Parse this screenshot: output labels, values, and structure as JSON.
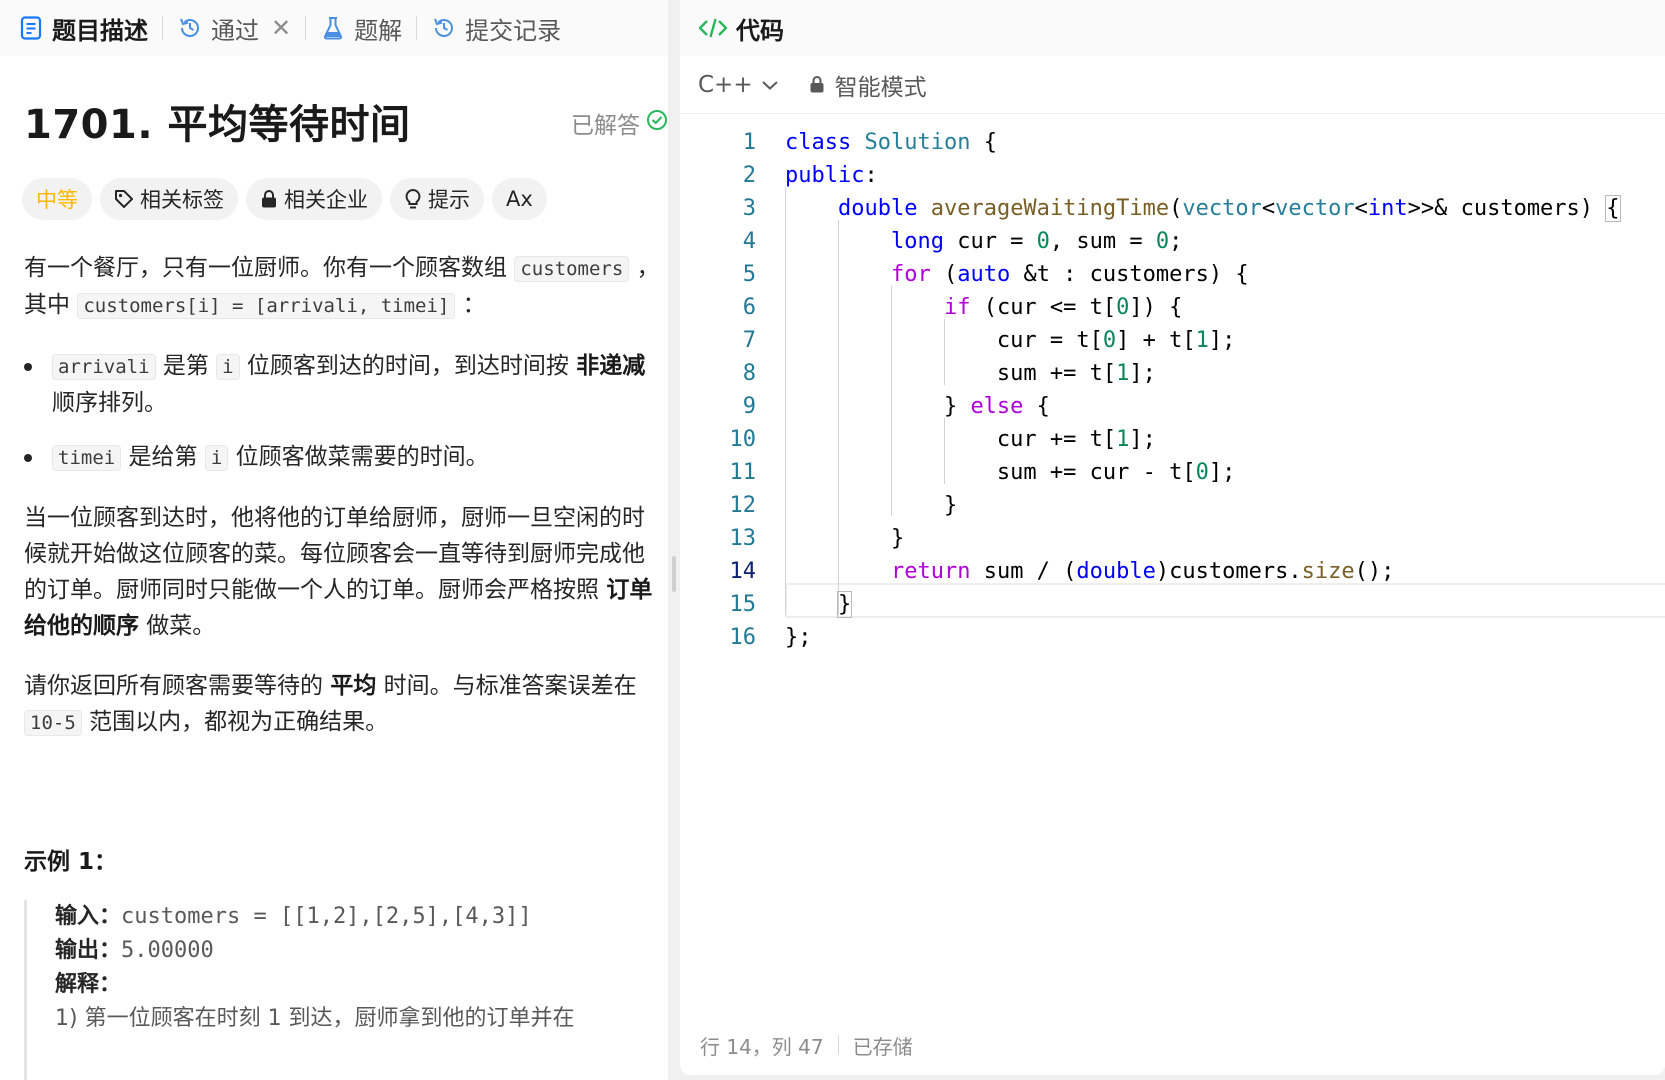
{
  "tabs": [
    {
      "label": "题目描述",
      "icon": "document-icon",
      "active": true
    },
    {
      "label": "通过",
      "icon": "history-icon",
      "closable": true
    },
    {
      "label": "题解",
      "icon": "flask-icon"
    },
    {
      "label": "提交记录",
      "icon": "history-icon"
    }
  ],
  "problem": {
    "title": "1701. 平均等待时间",
    "status": "已解答",
    "chips": {
      "difficulty": "中等",
      "tags": "相关标签",
      "companies": "相关企业",
      "hint": "提示",
      "font": "Ax"
    },
    "desc": {
      "p1_a": "有一个餐厅，只有一位厨师。你有一个顾客数组 ",
      "p1_code1": "customers",
      "p1_b": " ，其中 ",
      "p1_code2": "customers[i] = [arrivali, timei]",
      "p1_c": " ：",
      "b1_code": "arrivali",
      "b1_a": " 是第 ",
      "b1_i": "i",
      "b1_b": " 位顾客到达的时间，到达时间按 ",
      "b1_strong": "非递减",
      "b1_c": " 顺序排列。",
      "b2_code": "timei",
      "b2_a": " 是给第 ",
      "b2_i": "i",
      "b2_b": " 位顾客做菜需要的时间。",
      "p2_a": "当一位顾客到达时，他将他的订单给厨师，厨师一旦空闲的时候就开始做这位顾客的菜。每位顾客会一直等待到厨师完成他的订单。厨师同时只能做一个人的订单。厨师会严格按照 ",
      "p2_strong": "订单给他的顺序",
      "p2_b": " 做菜。",
      "p3_a": "请你返回所有顾客需要等待的 ",
      "p3_strong": "平均",
      "p3_b": " 时间。与标准答案误差在 ",
      "p3_code": "10-5",
      "p3_c": " 范围以内，都视为正确结果。"
    },
    "example": {
      "title": "示例 1：",
      "input_label": "输入：",
      "input": "customers = [[1,2],[2,5],[4,3]]",
      "output_label": "输出：",
      "output": "5.00000",
      "explain_label": "解释：",
      "explain": "1) 第一位顾客在时刻 1 到达，厨师拿到他的订单并在"
    }
  },
  "code_panel": {
    "title": "代码",
    "language": "C++",
    "mode": "智能模式",
    "status": {
      "position": "行 14，列 47",
      "saved": "已存储"
    }
  },
  "code_lines": [
    "class Solution {",
    "public:",
    "    double averageWaitingTime(vector<vector<int>>& customers) {",
    "        long cur = 0, sum = 0;",
    "        for (auto &t : customers) {",
    "            if (cur <= t[0]) {",
    "                cur = t[0] + t[1];",
    "                sum += t[1];",
    "            } else {",
    "                cur += t[1];",
    "                sum += cur - t[0];",
    "            }",
    "        }",
    "        return sum / (double)customers.size();",
    "    }",
    "};"
  ],
  "line_numbers": [
    "1",
    "2",
    "3",
    "4",
    "5",
    "6",
    "7",
    "8",
    "9",
    "10",
    "11",
    "12",
    "13",
    "14",
    "15",
    "16"
  ],
  "colors": {
    "accent_green": "#2db55d",
    "difficulty_yellow": "#ffb800",
    "keyword": "#0000ff",
    "control": "#af00db",
    "type": "#267f99",
    "function": "#795e26",
    "number": "#098658"
  }
}
